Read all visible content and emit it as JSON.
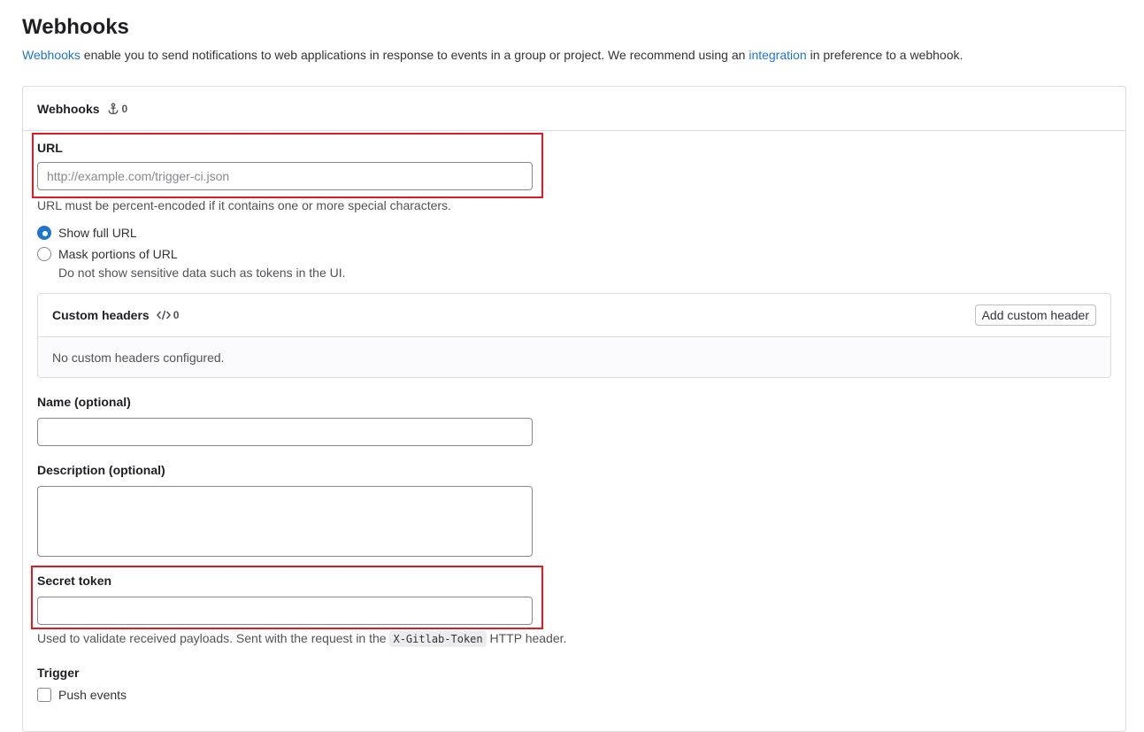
{
  "page": {
    "title": "Webhooks",
    "intro": {
      "link1": "Webhooks",
      "text1": " enable you to send notifications to web applications in response to events in a group or project. We recommend using an ",
      "link2": "integration",
      "text2": " in preference to a webhook."
    }
  },
  "card": {
    "title": "Webhooks",
    "count": "0"
  },
  "form": {
    "url": {
      "label": "URL",
      "placeholder": "http://example.com/trigger-ci.json",
      "value": "",
      "help": "URL must be percent-encoded if it contains one or more special characters."
    },
    "url_display": {
      "options": [
        {
          "label": "Show full URL",
          "checked": true
        },
        {
          "label": "Mask portions of URL",
          "checked": false,
          "help": "Do not show sensitive data such as tokens in the UI."
        }
      ]
    },
    "custom_headers": {
      "title": "Custom headers",
      "count": "0",
      "add_button": "Add custom header",
      "empty": "No custom headers configured."
    },
    "name": {
      "label": "Name (optional)",
      "value": ""
    },
    "description": {
      "label": "Description (optional)",
      "value": ""
    },
    "secret_token": {
      "label": "Secret token",
      "value": "",
      "help_prefix": "Used to validate received payloads. Sent with the request in the ",
      "help_code": "X-Gitlab-Token",
      "help_suffix": " HTTP header."
    },
    "trigger": {
      "label": "Trigger",
      "items": [
        {
          "label": "Push events",
          "checked": false
        }
      ]
    }
  },
  "colors": {
    "accent": "#1f75cb",
    "highlight": "#e11b24",
    "border": "#dcdcde"
  },
  "icons": {
    "webhook_count": "anchor-icon",
    "headers_count": "code-icon"
  }
}
